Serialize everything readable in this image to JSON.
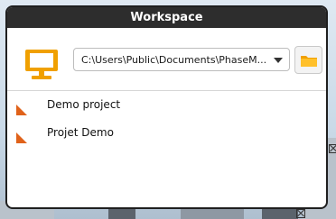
{
  "window": {
    "title": "Workspace"
  },
  "workspace": {
    "path_value": "C:\\Users\\Public\\Documents\\PhaseM..."
  },
  "icons": {
    "monitor": "monitor-icon",
    "folder": "folder-icon",
    "project": "project-flag-icon",
    "dropdown": "chevron-down-icon"
  },
  "projects": [
    {
      "label": "Demo project"
    },
    {
      "label": "Projet Demo"
    }
  ],
  "colors": {
    "titlebar": "#2d2d2d",
    "accent_orange": "#f0a000",
    "project_icon": "#e0621a"
  }
}
